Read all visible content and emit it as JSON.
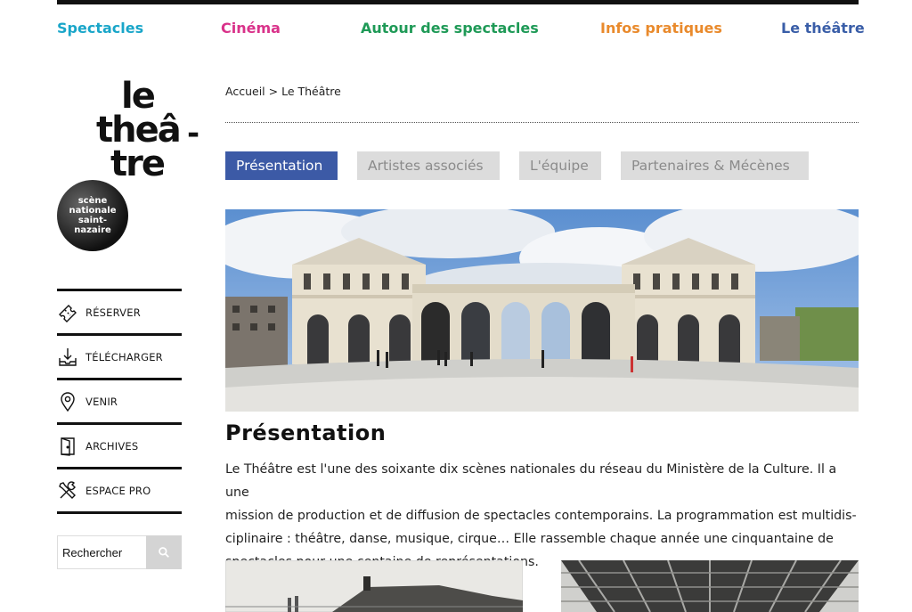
{
  "nav": [
    {
      "label": "Spectacles",
      "color": "#1aa6c9"
    },
    {
      "label": "Cinéma",
      "color": "#d9328a"
    },
    {
      "label": "Autour des spectacles",
      "color": "#1f9a57"
    },
    {
      "label": "Infos pratiques",
      "color": "#e98a2c"
    },
    {
      "label": "Le théâtre",
      "color": "#3a5ea8"
    }
  ],
  "logo": {
    "line1": "le",
    "line2": "theâ",
    "line3": "tre",
    "dash": "-",
    "badge": [
      "scène",
      "nationale",
      "saint-",
      "nazaire"
    ]
  },
  "sidebar": {
    "items": [
      {
        "label": "RÉSERVER",
        "icon": "ticket-icon"
      },
      {
        "label": "TÉLÉCHARGER",
        "icon": "download-icon"
      },
      {
        "label": "VENIR",
        "icon": "map-pin-icon"
      },
      {
        "label": "ARCHIVES",
        "icon": "archive-door-icon"
      },
      {
        "label": "ESPACE PRO",
        "icon": "tools-icon"
      }
    ]
  },
  "search": {
    "value": "Rechercher",
    "icon": "search-icon"
  },
  "breadcrumb": {
    "home": "Accueil",
    "separator": ">",
    "current": "Le Théâtre"
  },
  "tabs": [
    {
      "label": "Présentation",
      "active": true
    },
    {
      "label": "Artistes associés",
      "active": false
    },
    {
      "label": "L'équipe",
      "active": false
    },
    {
      "label": "Partenaires & Mécènes",
      "active": false
    }
  ],
  "content": {
    "title": "Présentation",
    "lines": [
      "Le Théâtre est l'une des soixante dix scènes nationales du réseau du Ministère de la Culture. Il a une",
      "mission de production et de diffusion de spectacles contemporains. La programmation est multidis-",
      "ciplinaire : théâtre, danse, musique, cirque… Elle rassemble chaque année une cinquantaine de",
      "spectacles pour une centaine de représentations."
    ]
  },
  "colors": {
    "accent": "#3c5aa6",
    "tab_inactive_bg": "#dcdcdc",
    "tab_inactive_text": "#8b8b8b"
  }
}
